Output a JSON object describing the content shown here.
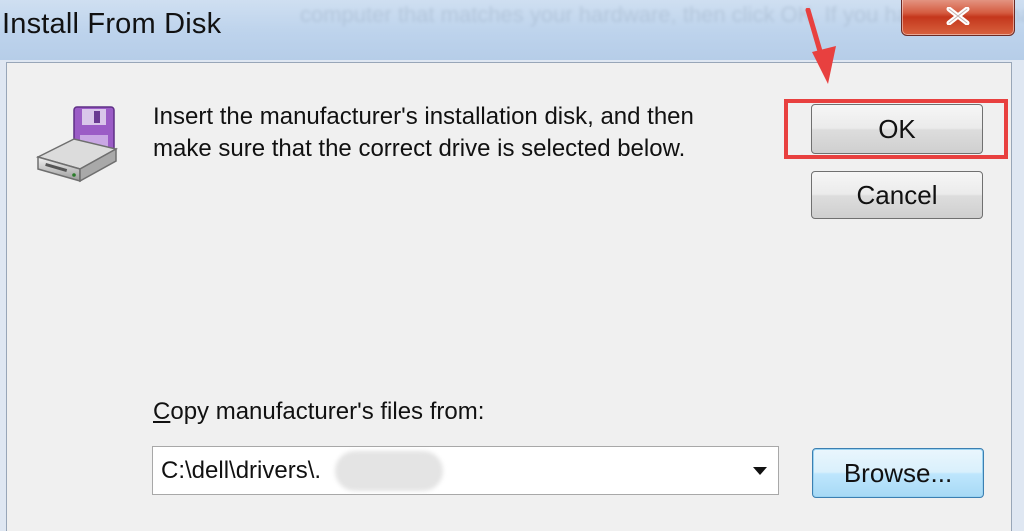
{
  "window": {
    "title": "Install From Disk",
    "background_text": "computer that matches your hardware, then click OK. If you have a disk that contains the driver you want to install, click Have Disk."
  },
  "dialog": {
    "instruction_line1": "Insert the manufacturer's installation disk, and then",
    "instruction_line2": "make sure that the correct drive is selected below.",
    "ok_label": "OK",
    "cancel_label": "Cancel",
    "copy_label_mnemonic": "C",
    "copy_label_rest": "opy manufacturer's files from:",
    "path_value": "C:\\dell\\drivers\\.",
    "browse_label": "Browse..."
  },
  "icons": {
    "close": "close-icon",
    "disk": "floppy-disk-drive-icon",
    "dropdown": "dropdown-arrow-icon"
  },
  "annotation": {
    "highlight_color": "#e8403f",
    "highlight_target": "ok-button"
  },
  "colors": {
    "titlebar": "#c4d8ee",
    "panel": "#f0f0f0",
    "close_button": "#c4371c",
    "browse_focus": "#3c7fb1"
  }
}
